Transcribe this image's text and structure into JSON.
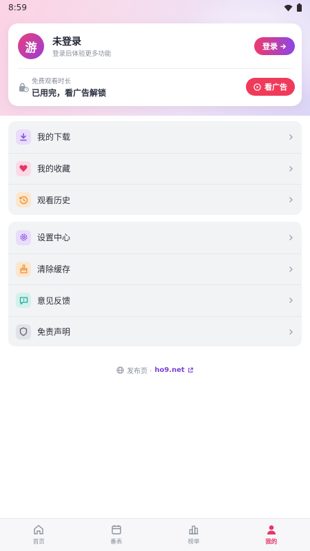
{
  "status_bar": {
    "time": "8:59"
  },
  "profile": {
    "avatar_char": "游",
    "name": "未登录",
    "subtitle": "登录后体验更多功能",
    "login_label": "登录",
    "quota_label": "免费观看时长",
    "quota_value": "已用完，看广告解锁",
    "ad_button_label": "看广告"
  },
  "menu_group_1": [
    {
      "label": "我的下载",
      "icon": "download-icon",
      "color": "#8c4fe0",
      "bg": "#e8ddfa"
    },
    {
      "label": "我的收藏",
      "icon": "heart-icon",
      "color": "#e8356b",
      "bg": "#fadbe5"
    },
    {
      "label": "观看历史",
      "icon": "history-icon",
      "color": "#ee8f2a",
      "bg": "#fbe6cf"
    }
  ],
  "menu_group_2": [
    {
      "label": "设置中心",
      "icon": "settings-icon",
      "color": "#8c4fe0",
      "bg": "#e8ddfa"
    },
    {
      "label": "清除缓存",
      "icon": "broom-icon",
      "color": "#ee8f2a",
      "bg": "#fbe6cf"
    },
    {
      "label": "意见反馈",
      "icon": "feedback-icon",
      "color": "#21a99a",
      "bg": "#d3f1ec"
    },
    {
      "label": "免责声明",
      "icon": "shield-icon",
      "color": "#5b6070",
      "bg": "#e1e3e8"
    }
  ],
  "footer": {
    "prefix": "发布页 ·",
    "domain": "ho9.net"
  },
  "tabs": [
    {
      "label": "首页",
      "icon": "home-icon"
    },
    {
      "label": "番表",
      "icon": "calendar-icon"
    },
    {
      "label": "榜单",
      "icon": "ranking-icon"
    },
    {
      "label": "我的",
      "icon": "user-icon",
      "active": true
    }
  ],
  "colors": {
    "accent": "#e8356b",
    "brand_purple": "#8c45e6",
    "ad_red": "#f03a5a"
  }
}
